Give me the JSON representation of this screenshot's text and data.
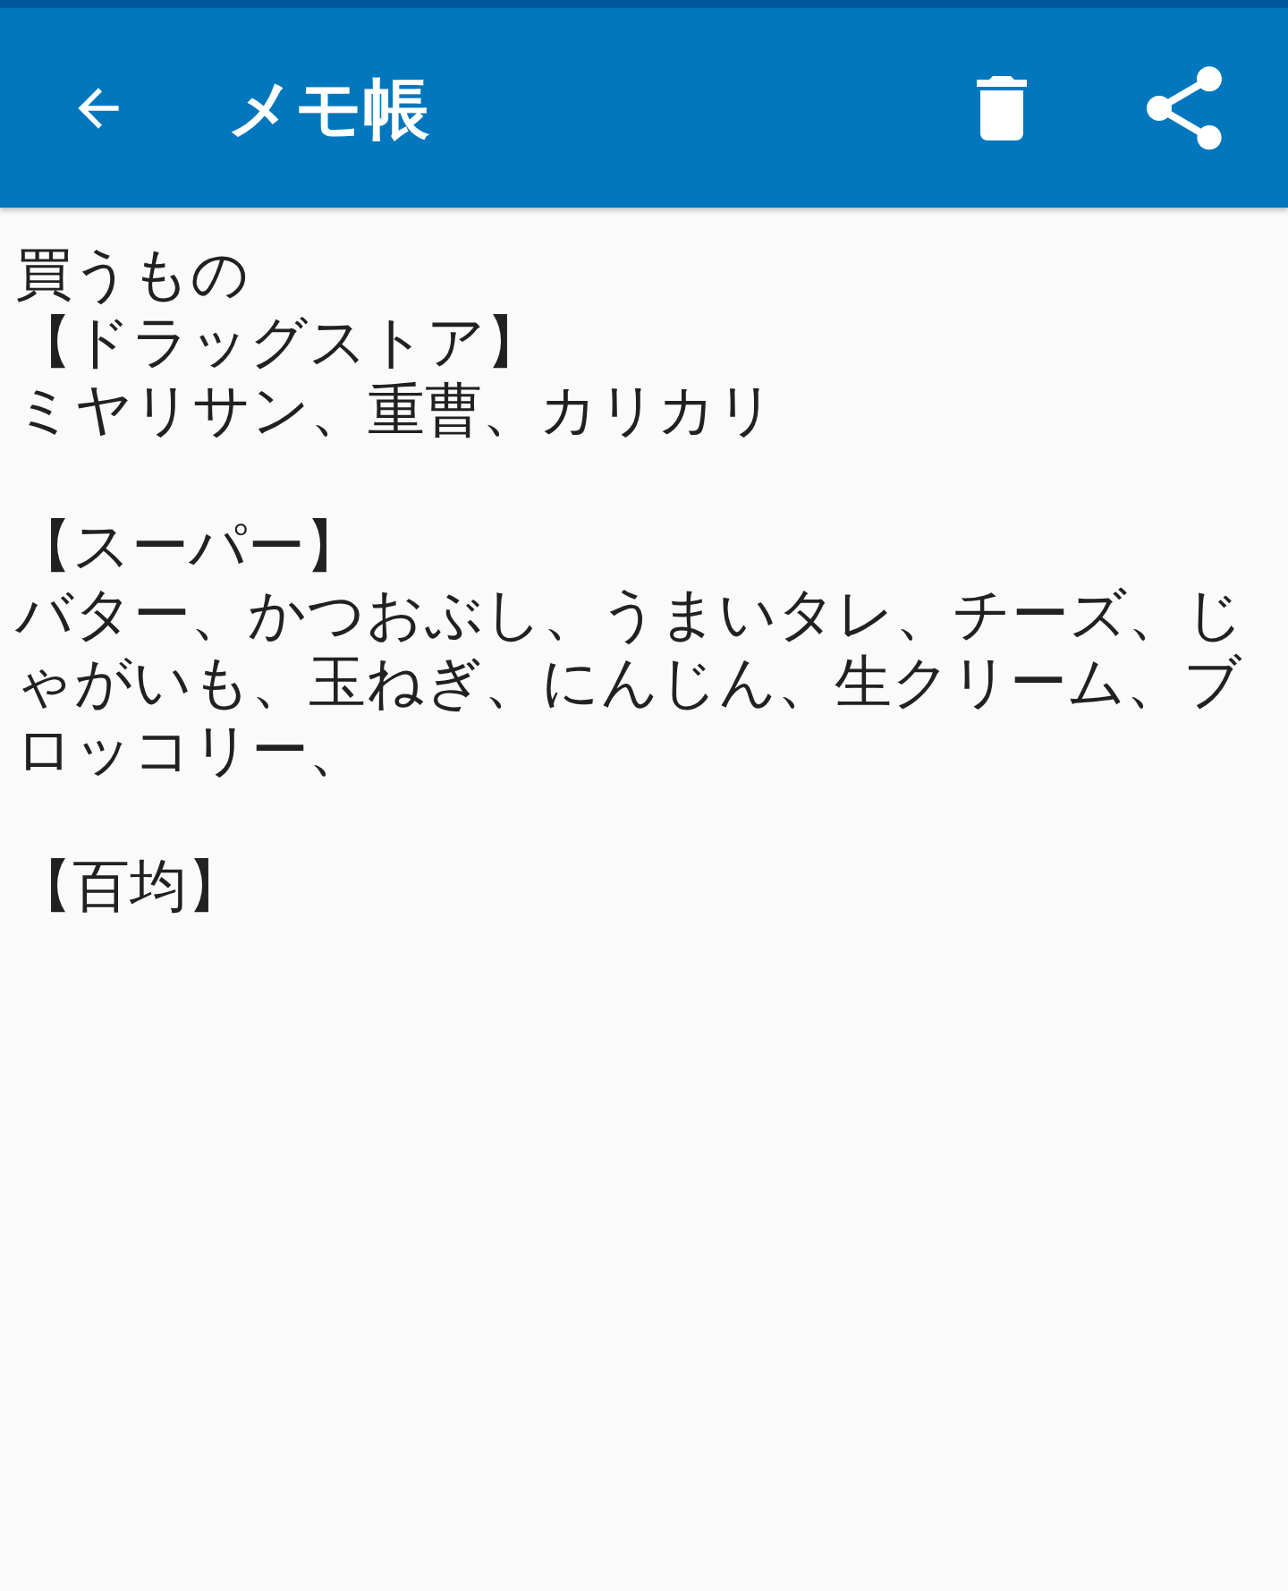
{
  "app_bar": {
    "title": "メモ帳"
  },
  "note": {
    "paragraphs": [
      [
        "買うもの",
        "【ドラッグストア】",
        "ミヤリサン、重曹、カリカリ"
      ],
      [
        "【スーパー】",
        "バター、かつおぶし、うまいタレ、チーズ、じゃがいも、玉ねぎ、にんじん、生クリーム、ブロッコリー、"
      ],
      [
        "【百均】"
      ]
    ]
  }
}
